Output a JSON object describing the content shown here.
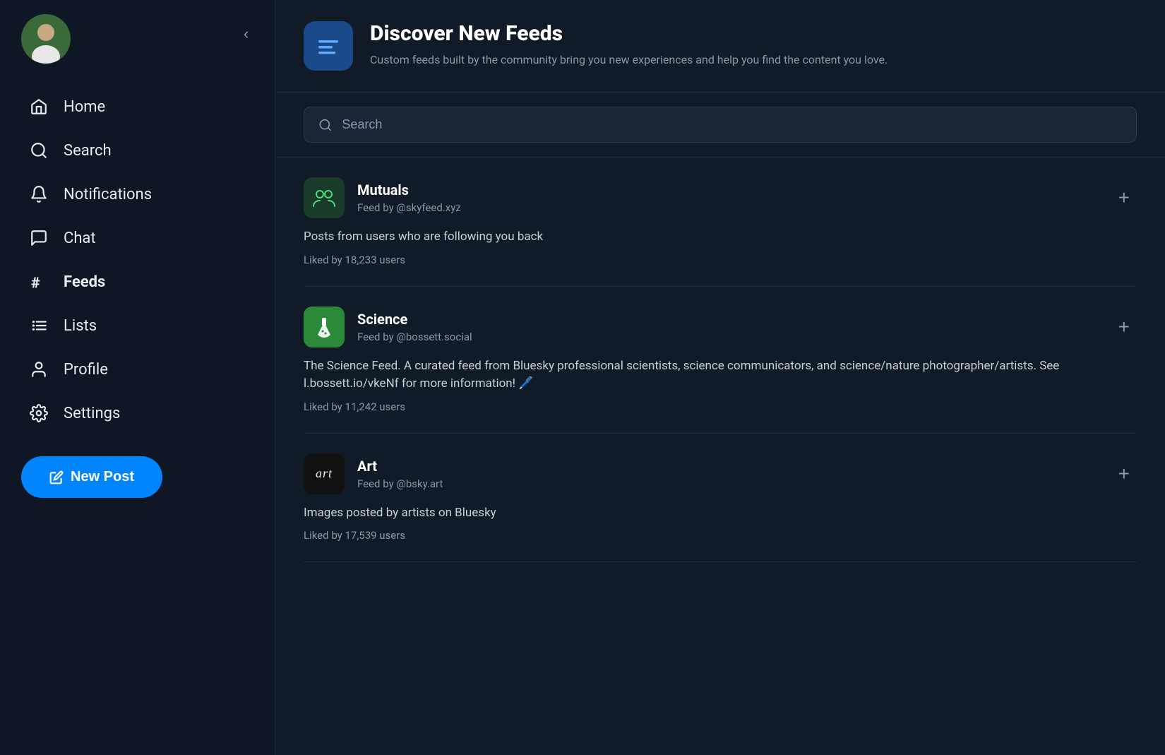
{
  "sidebar": {
    "collapse_btn": "‹",
    "nav_items": [
      {
        "id": "home",
        "label": "Home",
        "icon": "home-icon",
        "active": false
      },
      {
        "id": "search",
        "label": "Search",
        "icon": "search-icon",
        "active": false
      },
      {
        "id": "notifications",
        "label": "Notifications",
        "icon": "notifications-icon",
        "active": false
      },
      {
        "id": "chat",
        "label": "Chat",
        "icon": "chat-icon",
        "active": false
      },
      {
        "id": "feeds",
        "label": "Feeds",
        "icon": "feeds-icon",
        "active": true
      },
      {
        "id": "lists",
        "label": "Lists",
        "icon": "lists-icon",
        "active": false
      },
      {
        "id": "profile",
        "label": "Profile",
        "icon": "profile-icon",
        "active": false
      },
      {
        "id": "settings",
        "label": "Settings",
        "icon": "settings-icon",
        "active": false
      }
    ],
    "new_post_label": "New Post"
  },
  "main": {
    "header": {
      "title": "Discover New Feeds",
      "description": "Custom feeds built by the community bring you new experiences and help you find the content you love."
    },
    "search": {
      "placeholder": "Search"
    },
    "feeds": [
      {
        "id": "mutuals",
        "name": "Mutuals",
        "by": "Feed by @skyfeed.xyz",
        "description": "Posts from users who are following you back",
        "likes": "Liked by 18,233 users",
        "avatar_type": "mutuals"
      },
      {
        "id": "science",
        "name": "Science",
        "by": "Feed by @bossett.social",
        "description": "The Science Feed. A curated feed from Bluesky professional scientists,  science communicators, and science/nature photographer/artists. See l.bossett.io/vkeNf for more information! 🖊️",
        "likes": "Liked by 11,242 users",
        "avatar_type": "science"
      },
      {
        "id": "art",
        "name": "Art",
        "by": "Feed by @bsky.art",
        "description": "Images posted by artists on Bluesky",
        "likes": "Liked by 17,539 users",
        "avatar_type": "art",
        "avatar_text": "art"
      }
    ]
  }
}
